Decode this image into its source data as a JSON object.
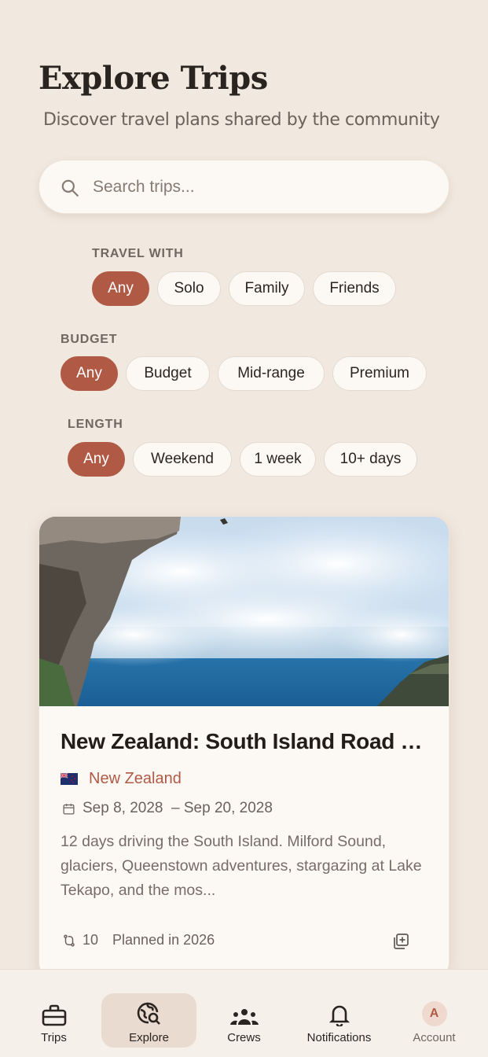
{
  "header": {
    "title": "Explore Trips",
    "subtitle": "Discover travel plans shared by the community"
  },
  "search": {
    "placeholder": "Search trips...",
    "value": ""
  },
  "filters": {
    "travel_with": {
      "label": "TRAVEL WITH",
      "options": [
        "Any",
        "Solo",
        "Family",
        "Friends"
      ],
      "selected": "Any"
    },
    "budget": {
      "label": "BUDGET",
      "options": [
        "Any",
        "Budget",
        "Mid-range",
        "Premium"
      ],
      "selected": "Any"
    },
    "length": {
      "label": "LENGTH",
      "options": [
        "Any",
        "Weekend",
        "1 week",
        "10+ days"
      ],
      "selected": "Any"
    }
  },
  "trip_card": {
    "title": "New Zealand: South Island Road Trip",
    "country": "New Zealand",
    "country_flag": "new-zealand-flag",
    "dates": "Sep 8, 2028  – Sep 20, 2028",
    "description": "12 days driving the South Island. Milford Sound, glaciers, Queenstown adventures, stargazing at Lake Tekapo, and the mos...",
    "forks": "10",
    "planned": "Planned in 2026"
  },
  "nav": {
    "items": [
      {
        "label": "Trips",
        "icon": "briefcase-icon"
      },
      {
        "label": "Explore",
        "icon": "globe-search-icon"
      },
      {
        "label": "Crews",
        "icon": "group-icon"
      },
      {
        "label": "Notifications",
        "icon": "bell-icon"
      },
      {
        "label": "Account",
        "avatar_letter": "A"
      }
    ],
    "active": "Explore"
  },
  "colors": {
    "background": "#f1e8df",
    "accent": "#b05a45",
    "card": "#fcf9f5"
  }
}
